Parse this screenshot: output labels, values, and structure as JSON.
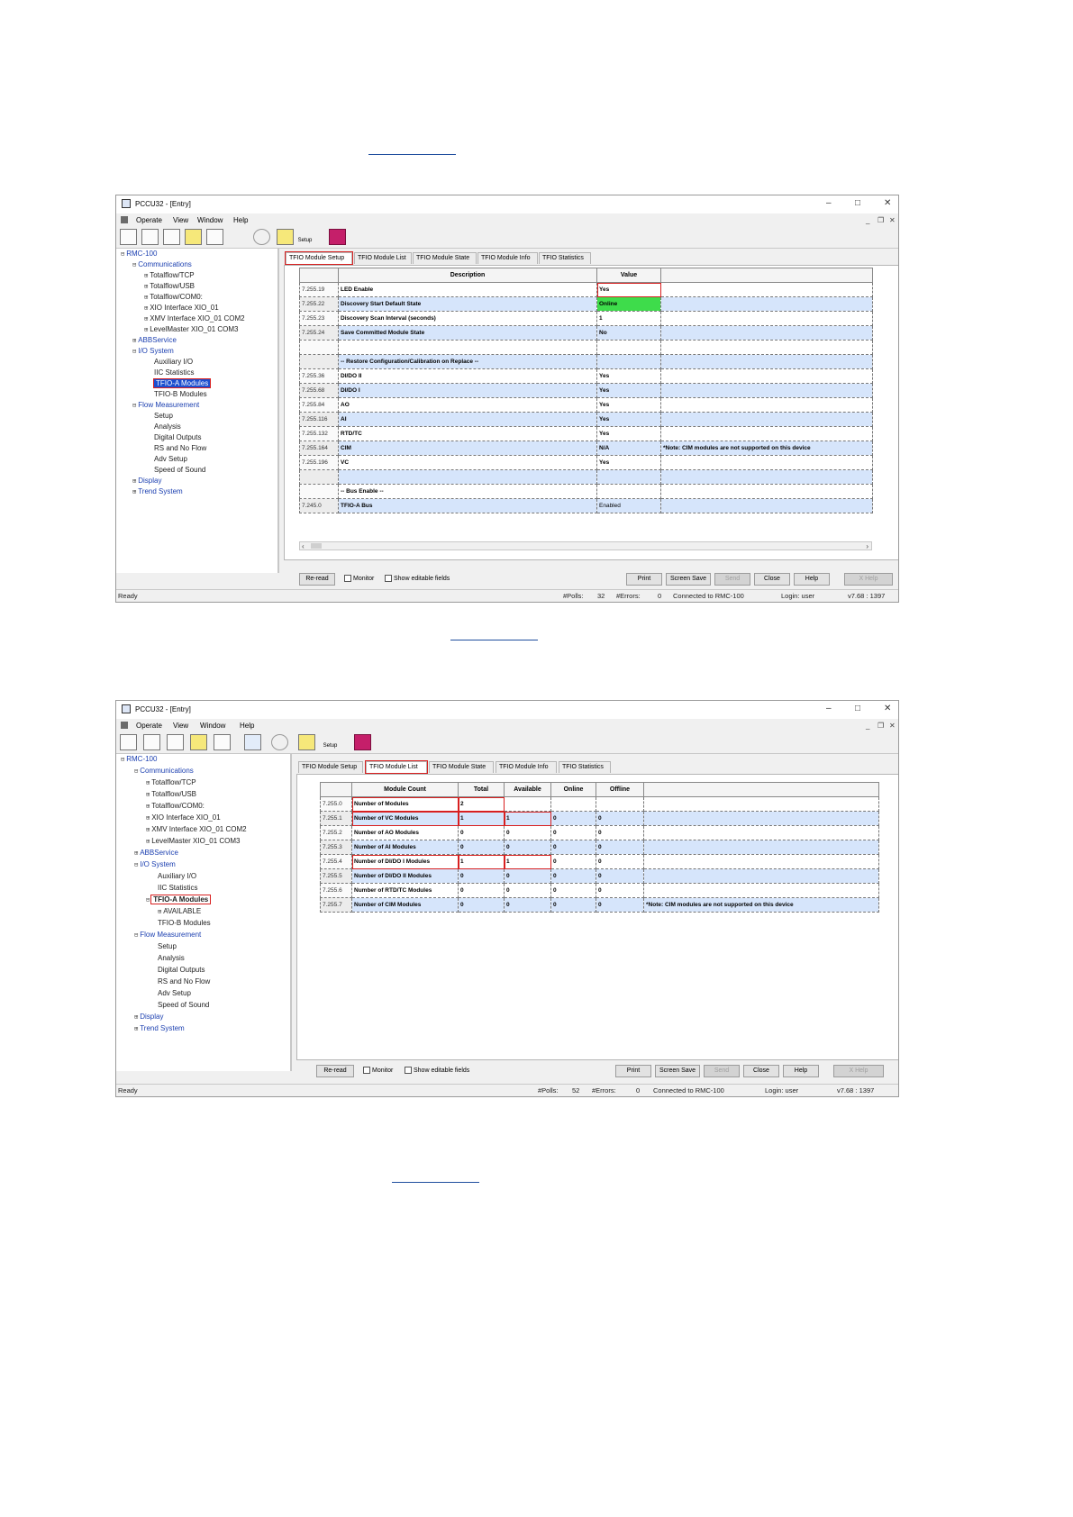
{
  "window1": {
    "title": "PCCU32 - [Entry]",
    "menu": [
      "Operate",
      "View",
      "Window",
      "Help"
    ],
    "toolbar": {
      "setup_label": "Setup"
    },
    "tree": {
      "root": "RMC-100",
      "nodes": [
        "Communications",
        "Totalflow/TCP",
        "Totalflow/USB",
        "Totalflow/COM0:",
        "XIO Interface XIO_01",
        "XMV Interface XIO_01 COM2",
        "LevelMaster XIO_01 COM3",
        "ABBService",
        "I/O System",
        "Auxiliary I/O",
        "IIC Statistics",
        "TFIO-A Modules",
        "TFIO-B Modules",
        "Flow Measurement",
        "Setup",
        "Analysis",
        "Digital Outputs",
        "RS and No Flow",
        "Adv Setup",
        "Speed of Sound",
        "Display",
        "Trend System"
      ]
    },
    "tabs": [
      "TFIO Module Setup",
      "TFIO Module List",
      "TFIO Module State",
      "TFIO Module Info",
      "TFIO Statistics"
    ],
    "grid": {
      "headers": [
        "",
        "Description",
        "Value",
        ""
      ],
      "rows": [
        {
          "reg": "7.255.19",
          "desc": "LED Enable",
          "value": "Yes",
          "note": ""
        },
        {
          "reg": "7.255.22",
          "desc": "Discovery Start Default State",
          "value": "Online",
          "note": ""
        },
        {
          "reg": "7.255.23",
          "desc": "Discovery Scan Interval (seconds)",
          "value": "1",
          "note": ""
        },
        {
          "reg": "7.255.24",
          "desc": "Save Committed Module State",
          "value": "No",
          "note": ""
        },
        {
          "reg": "",
          "desc": "",
          "value": "",
          "note": ""
        },
        {
          "reg": "",
          "desc": "-- Restore Configuration/Calibration on Replace --",
          "value": "",
          "note": ""
        },
        {
          "reg": "7.255.36",
          "desc": "DI/DO II",
          "value": "Yes",
          "note": ""
        },
        {
          "reg": "7.255.68",
          "desc": "DI/DO I",
          "value": "Yes",
          "note": ""
        },
        {
          "reg": "7.255.84",
          "desc": "AO",
          "value": "Yes",
          "note": ""
        },
        {
          "reg": "7.255.116",
          "desc": "AI",
          "value": "Yes",
          "note": ""
        },
        {
          "reg": "7.255.132",
          "desc": "RTD/TC",
          "value": "Yes",
          "note": ""
        },
        {
          "reg": "7.255.164",
          "desc": "CIM",
          "value": "N/A",
          "note": "*Note: CIM modules are not supported on this device"
        },
        {
          "reg": "7.255.196",
          "desc": "VC",
          "value": "Yes",
          "note": ""
        },
        {
          "reg": "",
          "desc": "",
          "value": "",
          "note": ""
        },
        {
          "reg": "",
          "desc": "-- Bus Enable --",
          "value": "",
          "note": ""
        },
        {
          "reg": "7.245.0",
          "desc": "TFIO-A Bus",
          "value": "Enabled",
          "note": ""
        }
      ]
    },
    "buttons": {
      "reread": "Re-read",
      "monitor": "Monitor",
      "editable": "Show editable fields",
      "print": "Print",
      "screen_save": "Screen Save",
      "send": "Send",
      "close": "Close",
      "help": "Help",
      "xhelp": "X Help"
    },
    "status": {
      "ready": "Ready",
      "polls_label": "#Polls:",
      "polls": "32",
      "errors_label": "#Errors:",
      "errors": "0",
      "connected": "Connected to RMC-100",
      "login": "Login: user",
      "version": "v7.68 : 1397"
    }
  },
  "window2": {
    "title": "PCCU32 - [Entry]",
    "menu": [
      "Operate",
      "View",
      "Window",
      "Help"
    ],
    "toolbar": {
      "setup_label": "Setup"
    },
    "tree": {
      "root": "RMC-100",
      "nodes": [
        "Communications",
        "Totalflow/TCP",
        "Totalflow/USB",
        "Totalflow/COM0:",
        "XIO Interface XIO_01",
        "XMV Interface XIO_01 COM2",
        "LevelMaster XIO_01 COM3",
        "ABBService",
        "I/O System",
        "Auxiliary I/O",
        "IIC Statistics",
        "TFIO-A Modules",
        "AVAILABLE",
        "TFIO-B Modules",
        "Flow Measurement",
        "Setup",
        "Analysis",
        "Digital Outputs",
        "RS and No Flow",
        "Adv Setup",
        "Speed of Sound",
        "Display",
        "Trend System"
      ]
    },
    "tabs": [
      "TFIO Module Setup",
      "TFIO Module List",
      "TFIO Module State",
      "TFIO Module Info",
      "TFIO Statistics"
    ],
    "grid": {
      "headers": [
        "",
        "Module Count",
        "Total",
        "Available",
        "Online",
        "Offline",
        ""
      ],
      "rows": [
        {
          "reg": "7.255.0",
          "desc": "Number of Modules",
          "total": "2",
          "available": "",
          "online": "",
          "offline": "",
          "note": ""
        },
        {
          "reg": "7.255.1",
          "desc": "Number of VC Modules",
          "total": "1",
          "available": "1",
          "online": "0",
          "offline": "0",
          "note": ""
        },
        {
          "reg": "7.255.2",
          "desc": "Number of AO Modules",
          "total": "0",
          "available": "0",
          "online": "0",
          "offline": "0",
          "note": ""
        },
        {
          "reg": "7.255.3",
          "desc": "Number of AI Modules",
          "total": "0",
          "available": "0",
          "online": "0",
          "offline": "0",
          "note": ""
        },
        {
          "reg": "7.255.4",
          "desc": "Number of DI/DO I Modules",
          "total": "1",
          "available": "1",
          "online": "0",
          "offline": "0",
          "note": ""
        },
        {
          "reg": "7.255.5",
          "desc": "Number of DI/DO II Modules",
          "total": "0",
          "available": "0",
          "online": "0",
          "offline": "0",
          "note": ""
        },
        {
          "reg": "7.255.6",
          "desc": "Number of RTD/TC Modules",
          "total": "0",
          "available": "0",
          "online": "0",
          "offline": "0",
          "note": ""
        },
        {
          "reg": "7.255.7",
          "desc": "Number of CIM Modules",
          "total": "0",
          "available": "0",
          "online": "0",
          "offline": "0",
          "note": "*Note: CIM modules are not supported on this device"
        }
      ]
    },
    "buttons": {
      "reread": "Re-read",
      "monitor": "Monitor",
      "editable": "Show editable fields",
      "print": "Print",
      "screen_save": "Screen Save",
      "send": "Send",
      "close": "Close",
      "help": "Help",
      "xhelp": "X Help"
    },
    "status": {
      "ready": "Ready",
      "polls_label": "#Polls:",
      "polls": "52",
      "errors_label": "#Errors:",
      "errors": "0",
      "connected": "Connected to RMC-100",
      "login": "Login: user",
      "version": "v7.68 : 1397"
    }
  },
  "colors": {
    "accent": "#1c4fd0",
    "highlight": "#d82020",
    "online_green": "#3edc4b",
    "row_alt": "#d6e5fb"
  }
}
